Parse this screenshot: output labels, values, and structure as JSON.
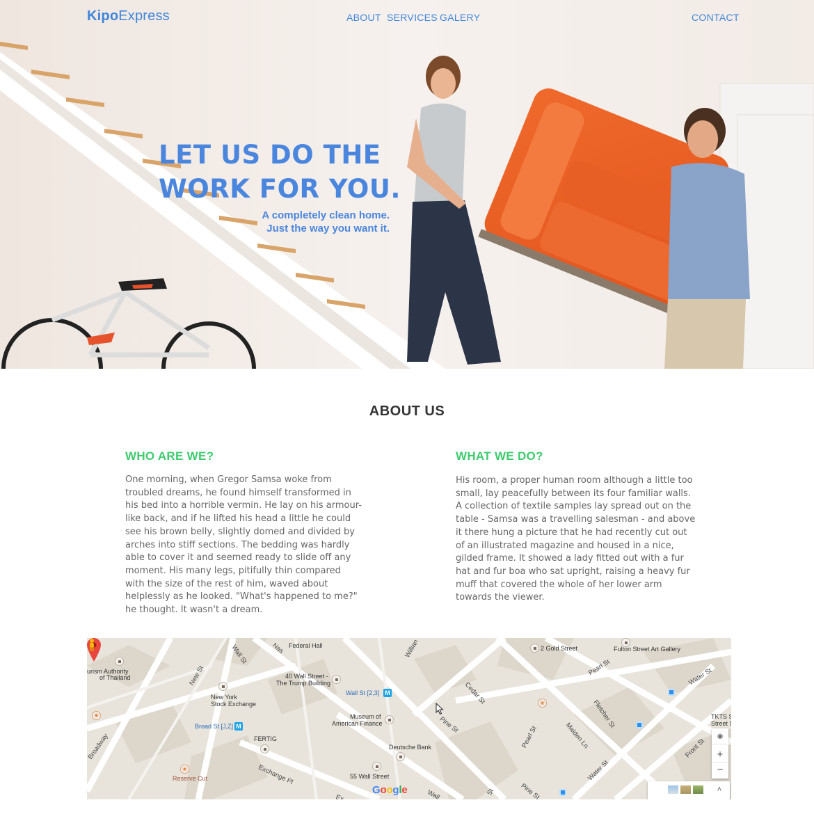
{
  "header": {
    "logo_bold": "Kipo",
    "logo_rest": "Express",
    "nav": {
      "about": "ABOUT",
      "services": "SERVICES",
      "galery": "GALERY",
      "contact": "CONTACT"
    }
  },
  "hero": {
    "title_line1": "LET US DO THE",
    "title_line2": "WORK FOR YOU.",
    "subtitle_line1": "A completely clean home.",
    "subtitle_line2": "Just the way you want it."
  },
  "about": {
    "title": "ABOUT US",
    "left": {
      "title": "WHO ARE WE?",
      "text": "One morning, when Gregor Samsa woke from troubled dreams, he found himself transformed in his bed into a horrible vermin. He lay on his armour-like back, and if he lifted his head a little he could see his brown belly, slightly domed and divided by arches into stiff sections. The bedding was hardly able to cover it and seemed ready to slide off any moment. His many legs, pitifully thin compared with the size of the rest of him, waved about helplessly as he looked. \"What's happened to me?\" he thought. It wasn't a dream."
    },
    "right": {
      "title": "WHAT WE DO?",
      "text": "His room, a proper human room although a little too small, lay peacefully between its four familiar walls. A collection of textile samples lay spread out on the table - Samsa was a travelling salesman - and above it there hung a picture that he had recently cut out of an illustrated magazine and housed in a nice, gilded frame. It showed a lady fitted out with a fur hat and fur boa who sat upright, raising a heavy fur muff that covered the whole of her lower arm towards the viewer."
    }
  },
  "map": {
    "labels": {
      "federal_hall": "Federal Hall",
      "tourism_1": "urism Authority",
      "tourism_2": "of Thailand",
      "wall40_1": "40 Wall Street -",
      "wall40_2": "The Trump Building",
      "wallst_metro": "Wall St [2,3]",
      "nyse_1": "New York",
      "nyse_2": "Stock Exchange",
      "museum_1": "Museum of",
      "museum_2": "American Finance",
      "broad_metro": "Broad St [J,Z]",
      "fertig": "FERTIG",
      "deutsche": "Deutsche Bank",
      "wall55": "55 Wall Street",
      "reserve": "Reserve Cut",
      "gold2": "2 Gold Street",
      "fulton": "Fulton Street Art Gallery",
      "tkts_1": "TKTS S",
      "tkts_2": "Street S"
    },
    "streets": {
      "wall_st_1": "Wall St",
      "nas": "Nas",
      "new_st": "New St",
      "broadway": "Broadway",
      "exchange_pl": "Exchange Pl",
      "ex": "Ex",
      "william": "Willian",
      "cedar": "Cedar St",
      "pine_1": "Pine St",
      "pine_2": "Pine St",
      "pearl_1": "Pearl St",
      "pearl_2": "Pearl St",
      "fletcher": "Fletcher St",
      "maiden": "Maiden Ln",
      "water_1": "Water St",
      "water_2": "Water St",
      "front": "Front St",
      "wall_st_2": "Wall",
      "st_small": "St"
    },
    "google": [
      "G",
      "o",
      "o",
      "g",
      "l",
      "e"
    ],
    "google_colors": [
      "#4285f4",
      "#ea4335",
      "#fbbc05",
      "#4285f4",
      "#34a853",
      "#ea4335"
    ],
    "zoom_in": "+",
    "zoom_out": "−"
  },
  "colors": {
    "accent_blue": "#3f86dc",
    "accent_green": "#3ccc6d"
  }
}
